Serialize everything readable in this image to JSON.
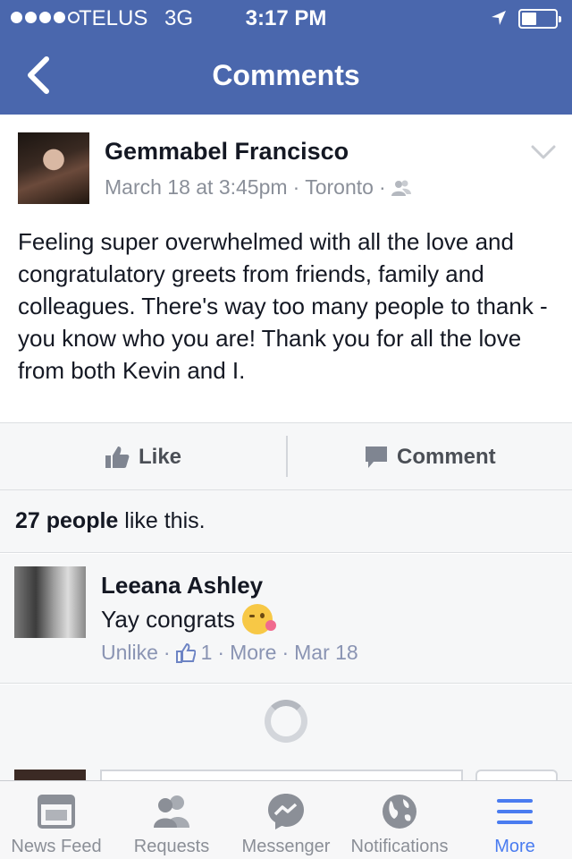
{
  "status_bar": {
    "carrier": "TELUS",
    "network": "3G",
    "time": "3:17 PM",
    "signal_bars_filled": 4,
    "signal_bars_total": 5
  },
  "nav": {
    "title": "Comments",
    "back_icon": "chevron-left-icon"
  },
  "post": {
    "author": "Gemmabel Francisco",
    "date": "March 18 at 3:45pm",
    "separator": "·",
    "location": "Toronto",
    "audience_icon": "friends-icon",
    "body": "Feeling super overwhelmed with all the love and congratulatory greets from friends, family and colleagues. There's way too many people to thank - you know who you are! Thank you for all the love from both Kevin and I."
  },
  "actions": {
    "like_label": "Like",
    "comment_label": "Comment"
  },
  "likes": {
    "count_text": "27 people",
    "suffix": "like this."
  },
  "comments": [
    {
      "author": "Leeana Ashley",
      "text": "Yay congrats",
      "unlike": "Unlike",
      "like_count": "1",
      "more": "More",
      "date": "Mar 18",
      "sep": "·"
    }
  ],
  "tabs": [
    {
      "label": "News Feed",
      "icon": "news-feed-icon"
    },
    {
      "label": "Requests",
      "icon": "friend-requests-icon"
    },
    {
      "label": "Messenger",
      "icon": "messenger-icon"
    },
    {
      "label": "Notifications",
      "icon": "globe-icon"
    },
    {
      "label": "More",
      "icon": "menu-icon",
      "active": true
    }
  ],
  "colors": {
    "brand_blue": "#4a67ad",
    "active_tab": "#4a7cf0",
    "meta_gray": "#8a8f99",
    "link_blue_gray": "#8a94b3"
  }
}
